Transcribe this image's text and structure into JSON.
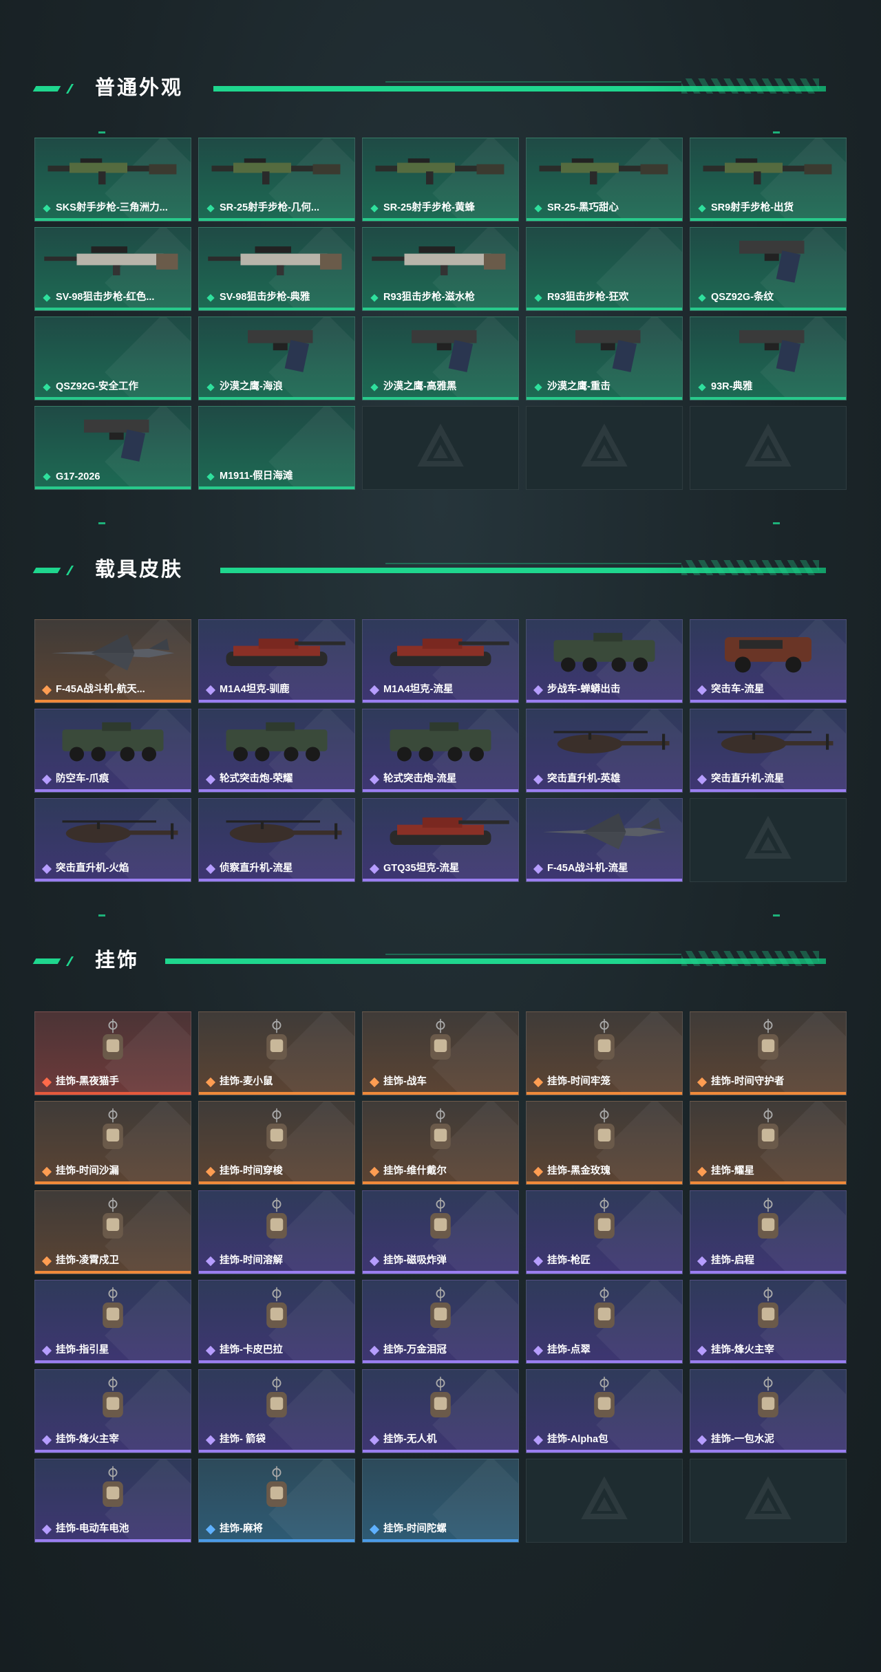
{
  "sections": [
    {
      "title": "普通外观",
      "items": [
        {
          "label": "SKS射手步枪-三角洲力...",
          "rarity": "green",
          "icon": "rifle-icon"
        },
        {
          "label": "SR-25射手步枪-几何...",
          "rarity": "green",
          "icon": "rifle-icon"
        },
        {
          "label": "SR-25射手步枪-黄蜂",
          "rarity": "green",
          "icon": "rifle-icon"
        },
        {
          "label": "SR-25-黑巧甜心",
          "rarity": "green",
          "icon": "rifle-icon"
        },
        {
          "label": "SR9射手步枪-出货",
          "rarity": "green",
          "icon": "rifle-icon"
        },
        {
          "label": "SV-98狙击步枪-红色...",
          "rarity": "green",
          "icon": "sniper-icon"
        },
        {
          "label": "SV-98狙击步枪-典雅",
          "rarity": "green",
          "icon": "sniper-icon"
        },
        {
          "label": "R93狙击步枪-滋水枪",
          "rarity": "green",
          "icon": "sniper-icon"
        },
        {
          "label": "R93狙击步枪-狂欢",
          "rarity": "green",
          "icon": ""
        },
        {
          "label": "QSZ92G-条纹",
          "rarity": "green",
          "icon": "pistol-icon"
        },
        {
          "label": "QSZ92G-安全工作",
          "rarity": "green",
          "icon": ""
        },
        {
          "label": "沙漠之鹰-海浪",
          "rarity": "green",
          "icon": "pistol-icon"
        },
        {
          "label": "沙漠之鹰-高雅黑",
          "rarity": "green",
          "icon": "pistol-icon"
        },
        {
          "label": "沙漠之鹰-重击",
          "rarity": "green",
          "icon": "pistol-icon"
        },
        {
          "label": "93R-典雅",
          "rarity": "green",
          "icon": "pistol-icon"
        },
        {
          "label": "G17-2026",
          "rarity": "green",
          "icon": "pistol-icon"
        },
        {
          "label": "M1911-假日海滩",
          "rarity": "green",
          "icon": ""
        },
        {
          "label": "",
          "rarity": "empty",
          "icon": "logo-icon"
        },
        {
          "label": "",
          "rarity": "empty",
          "icon": "logo-icon"
        },
        {
          "label": "",
          "rarity": "empty",
          "icon": "logo-icon"
        }
      ]
    },
    {
      "title": "载具皮肤",
      "items": [
        {
          "label": "F-45A战斗机-航天...",
          "rarity": "orange",
          "icon": "jet-icon"
        },
        {
          "label": "M1A4坦克-驯鹿",
          "rarity": "purple",
          "icon": "tank-icon"
        },
        {
          "label": "M1A4坦克-流星",
          "rarity": "purple",
          "icon": "tank-icon"
        },
        {
          "label": "步战车-蝉蟒出击",
          "rarity": "purple",
          "icon": "apc-icon"
        },
        {
          "label": "突击车-流星",
          "rarity": "purple",
          "icon": "truck-icon"
        },
        {
          "label": "防空车-爪痕",
          "rarity": "purple",
          "icon": "apc-icon"
        },
        {
          "label": "轮式突击炮-荣耀",
          "rarity": "purple",
          "icon": "apc-icon"
        },
        {
          "label": "轮式突击炮-流星",
          "rarity": "purple",
          "icon": "apc-icon"
        },
        {
          "label": "突击直升机-英雄",
          "rarity": "purple",
          "icon": "helicopter-icon"
        },
        {
          "label": "突击直升机-流星",
          "rarity": "purple",
          "icon": "helicopter-icon"
        },
        {
          "label": "突击直升机-火焰",
          "rarity": "purple",
          "icon": "helicopter-icon"
        },
        {
          "label": "侦察直升机-流星",
          "rarity": "purple",
          "icon": "helicopter-icon"
        },
        {
          "label": "GTQ35坦克-流星",
          "rarity": "purple",
          "icon": "tank-icon"
        },
        {
          "label": "F-45A战斗机-流星",
          "rarity": "purple",
          "icon": "jet-icon"
        },
        {
          "label": "",
          "rarity": "empty",
          "icon": "logo-icon"
        }
      ]
    },
    {
      "title": "挂饰",
      "items": [
        {
          "label": "挂饰-黑夜猫手",
          "rarity": "red",
          "icon": "charm-icon"
        },
        {
          "label": "挂饰-麦小鼠",
          "rarity": "orange",
          "icon": "charm-icon"
        },
        {
          "label": "挂饰-战车",
          "rarity": "orange",
          "icon": "charm-icon"
        },
        {
          "label": "挂饰-时间牢笼",
          "rarity": "orange",
          "icon": "charm-icon"
        },
        {
          "label": "挂饰-时间守护者",
          "rarity": "orange",
          "icon": "charm-icon"
        },
        {
          "label": "挂饰-时间沙漏",
          "rarity": "orange",
          "icon": "charm-icon"
        },
        {
          "label": "挂饰-时间穿梭",
          "rarity": "orange",
          "icon": "charm-icon"
        },
        {
          "label": "挂饰-维什戴尔",
          "rarity": "orange",
          "icon": "charm-icon"
        },
        {
          "label": "挂饰-黑金玫瑰",
          "rarity": "orange",
          "icon": "charm-icon"
        },
        {
          "label": "挂饰-耀星",
          "rarity": "orange",
          "icon": "charm-icon"
        },
        {
          "label": "挂饰-凌霄戍卫",
          "rarity": "orange",
          "icon": "charm-icon"
        },
        {
          "label": "挂饰-时间溶解",
          "rarity": "purple",
          "icon": "charm-icon"
        },
        {
          "label": "挂饰-磁吸炸弹",
          "rarity": "purple",
          "icon": "charm-icon"
        },
        {
          "label": "挂饰-枪匠",
          "rarity": "purple",
          "icon": "charm-icon"
        },
        {
          "label": "挂饰-启程",
          "rarity": "purple",
          "icon": "charm-icon"
        },
        {
          "label": "挂饰-指引星",
          "rarity": "purple",
          "icon": "charm-icon"
        },
        {
          "label": "挂饰-卡皮巴拉",
          "rarity": "purple",
          "icon": "charm-icon"
        },
        {
          "label": "挂饰-万金泪冠",
          "rarity": "purple",
          "icon": "charm-icon"
        },
        {
          "label": "挂饰-点翠",
          "rarity": "purple",
          "icon": "charm-icon"
        },
        {
          "label": "挂饰-烽火主宰",
          "rarity": "purple",
          "icon": "charm-icon"
        },
        {
          "label": "挂饰-烽火主宰",
          "rarity": "purple",
          "icon": "charm-icon"
        },
        {
          "label": "挂饰- 箭袋",
          "rarity": "purple",
          "icon": "charm-icon"
        },
        {
          "label": "挂饰-无人机",
          "rarity": "purple",
          "icon": "charm-icon"
        },
        {
          "label": "挂饰-Alpha包",
          "rarity": "purple",
          "icon": "charm-icon"
        },
        {
          "label": "挂饰-一包水泥",
          "rarity": "purple",
          "icon": "charm-icon"
        },
        {
          "label": "挂饰-电动车电池",
          "rarity": "purple",
          "icon": "charm-icon"
        },
        {
          "label": "挂饰-麻将",
          "rarity": "blue",
          "icon": "charm-icon"
        },
        {
          "label": "挂饰-时间陀螺",
          "rarity": "blue",
          "icon": ""
        },
        {
          "label": "",
          "rarity": "empty",
          "icon": "logo-icon"
        },
        {
          "label": "",
          "rarity": "empty",
          "icon": "logo-icon"
        }
      ]
    }
  ],
  "colors": {
    "accent": "#1fd68e",
    "green": "#28c98b",
    "purple": "#9a7ef0",
    "orange": "#f08a3a",
    "red": "#e5593c",
    "blue": "#4b9be8"
  }
}
